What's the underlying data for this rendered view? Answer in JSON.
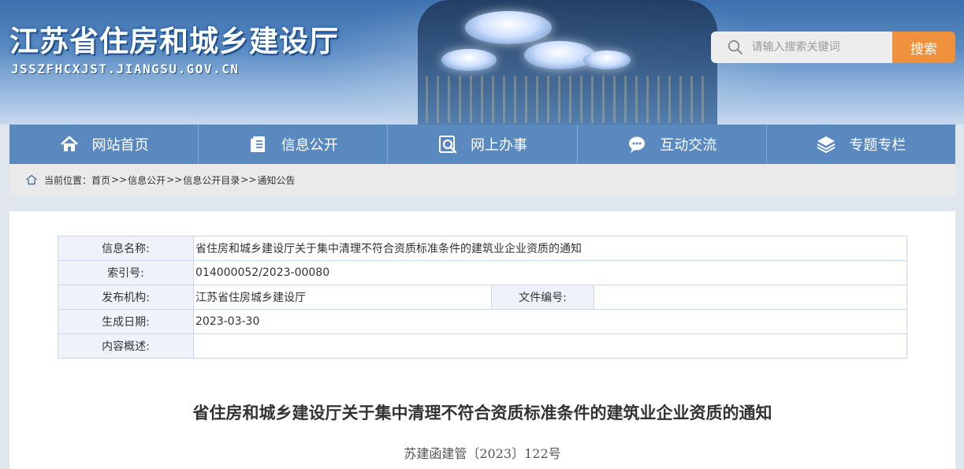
{
  "header": {
    "site_title": "江苏省住房和城乡建设厅",
    "site_domain": "JSSZFHCXJST.JIANGSU.GOV.CN",
    "search": {
      "placeholder": "请输入搜索关键词",
      "button_label": "搜索"
    }
  },
  "nav": {
    "items": [
      {
        "label": "网站首页",
        "icon": "home-icon"
      },
      {
        "label": "信息公开",
        "icon": "document-icon"
      },
      {
        "label": "网上办事",
        "icon": "search-document-icon"
      },
      {
        "label": "互动交流",
        "icon": "chat-icon"
      },
      {
        "label": "专题专栏",
        "icon": "layers-icon"
      }
    ]
  },
  "breadcrumb": {
    "label": "当前位置：",
    "items": [
      "首页",
      "信息公开",
      "信息公开目录",
      "通知公告"
    ],
    "separator": ">>"
  },
  "meta_table": {
    "info_name_label": "信息名称:",
    "info_name_value": "省住房和城乡建设厅关于集中清理不符合资质标准条件的建筑业企业资质的通知",
    "index_label": "索引号:",
    "index_value": "014000052/2023-00080",
    "publisher_label": "发布机构:",
    "publisher_value": "江苏省住房城乡建设厅",
    "doc_no_label": "文件编号:",
    "doc_no_value": "",
    "date_label": "生成日期:",
    "date_value": "2023-03-30",
    "summary_label": "内容概述:",
    "summary_value": ""
  },
  "document": {
    "title": "省住房和城乡建设厅关于集中清理不符合资质标准条件的建筑业企业资质的通知",
    "number": "苏建函建管〔2023〕122号"
  },
  "colors": {
    "nav_bg": "#5a89c0",
    "search_button": "#f0913d",
    "table_label_bg": "#eef3fa"
  }
}
